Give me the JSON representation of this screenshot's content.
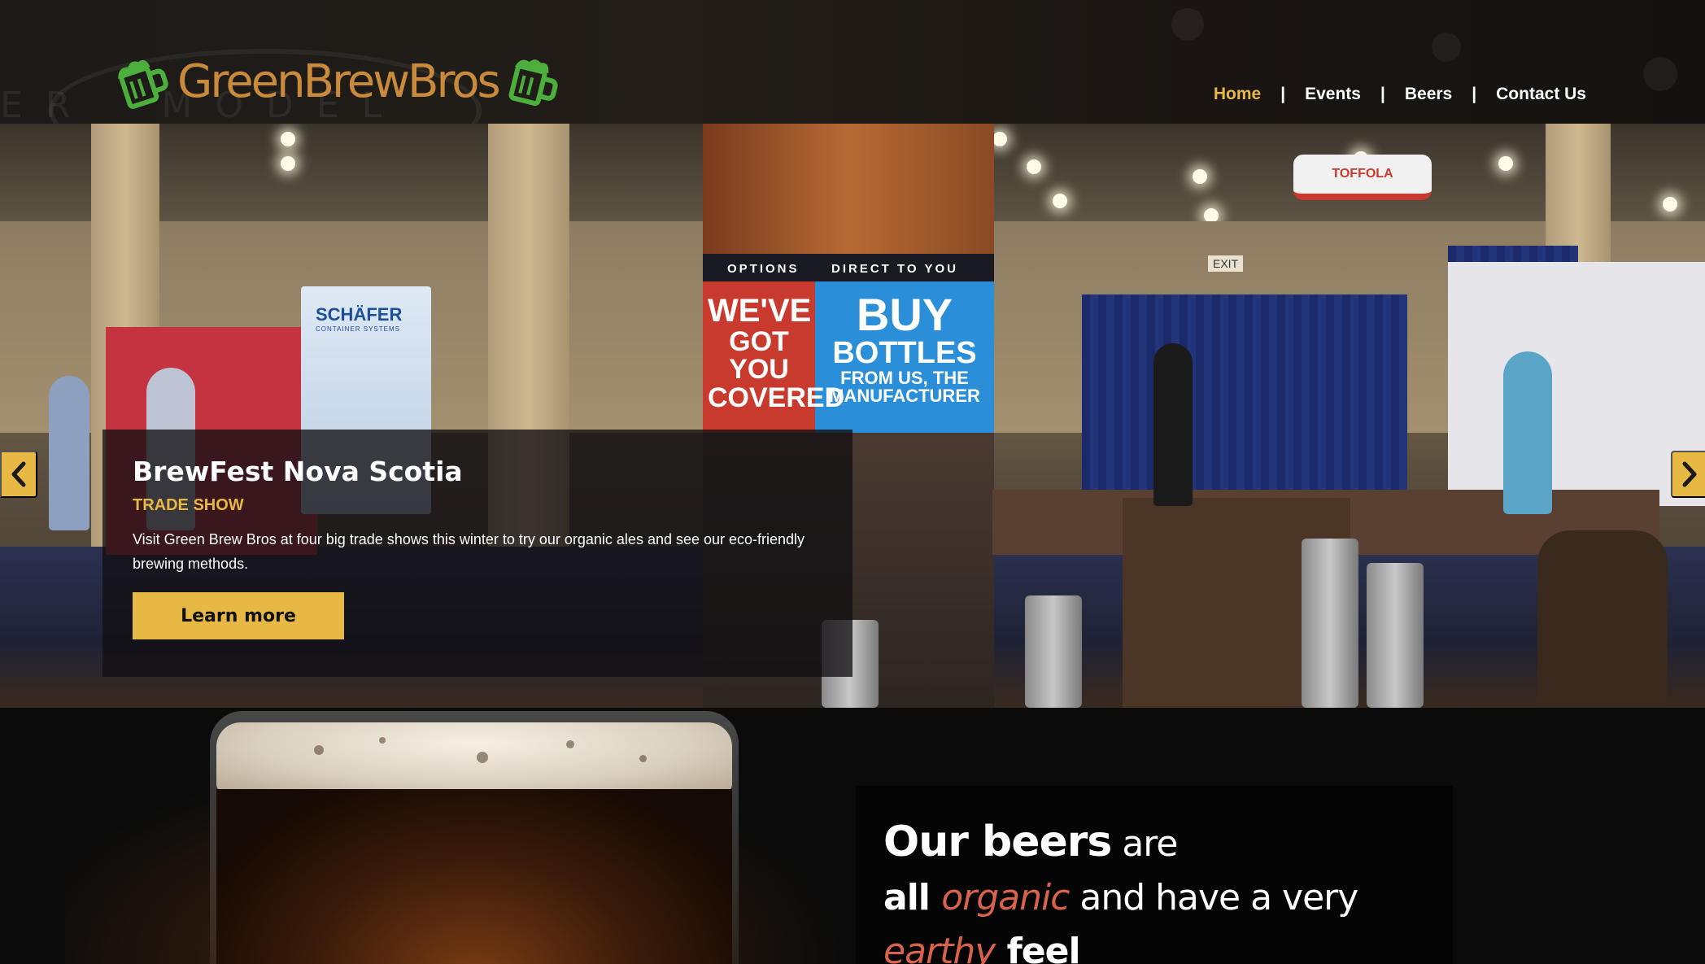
{
  "header": {
    "logo_text": "GreenBrewBros",
    "nav": [
      {
        "label": "Home",
        "active": true
      },
      {
        "label": "Events",
        "active": false
      },
      {
        "label": "Beers",
        "active": false
      },
      {
        "label": "Contact Us",
        "active": false
      }
    ],
    "separator": "|"
  },
  "hero": {
    "background_scene": {
      "bottle_banner_left": [
        "OPTIONS",
        "WE'VE",
        "GOT YOU",
        "COVERED"
      ],
      "bottle_banner_right": [
        "DIRECT TO YOU",
        "BUY",
        "BOTTLES",
        "FROM US, THE",
        "MANUFACTURER"
      ],
      "booth_brand": "SCHÄFER",
      "booth_sub": "CONTAINER SYSTEMS",
      "hanging_sign": "TOFFOLA",
      "exit_sign": "EXIT"
    },
    "slide": {
      "title": "BrewFest Nova Scotia",
      "tag": "TRADE SHOW",
      "description": "Visit Green Brew Bros at four big trade shows this winter to try our organic ales and see our eco-friendly brewing methods.",
      "cta_label": "Learn more"
    },
    "prev_icon": "chevron-left-icon",
    "next_icon": "chevron-right-icon"
  },
  "feature": {
    "part1": "Our beers",
    "part2": " are",
    "part3": "all ",
    "part4": "organic",
    "part5": " and have a very",
    "part6": "earthy",
    "part7": " feel"
  },
  "colors": {
    "accent": "#e8b845",
    "logo_green": "#4caf3c",
    "logo_brown": "#c98a3b",
    "emphasis": "#d9624a"
  }
}
